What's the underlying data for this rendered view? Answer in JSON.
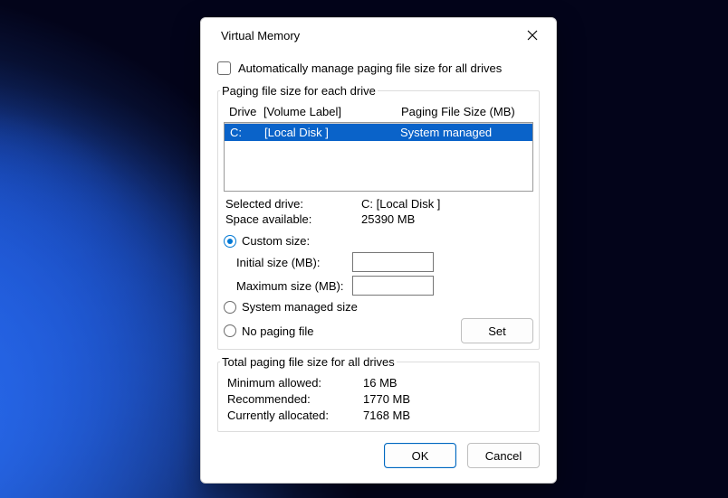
{
  "title": "Virtual Memory",
  "autoManage": {
    "label": "Automatically manage paging file size for all drives",
    "checked": false
  },
  "driveGroup": {
    "legend": "Paging file size for each drive",
    "headerDrive": "Drive",
    "headerLabel": "[Volume Label]",
    "headerSize": "Paging File Size (MB)",
    "rows": [
      {
        "drive": "C:",
        "label": "[Local Disk ]",
        "size": "System managed",
        "selected": true
      }
    ],
    "selectedLabel": "Selected drive:",
    "selectedValue": "C:  [Local Disk ]",
    "spaceLabel": "Space available:",
    "spaceValue": "25390 MB",
    "customLabel": "Custom size:",
    "initialLabel": "Initial size (MB):",
    "initialValue": "",
    "maxLabel": "Maximum size (MB):",
    "maxValue": "",
    "systemManagedLabel": "System managed size",
    "noPagingLabel": "No paging file",
    "choice": "custom",
    "setLabel": "Set"
  },
  "totals": {
    "legend": "Total paging file size for all drives",
    "minLabel": "Minimum allowed:",
    "minValue": "16 MB",
    "recLabel": "Recommended:",
    "recValue": "1770 MB",
    "curLabel": "Currently allocated:",
    "curValue": "7168 MB"
  },
  "buttons": {
    "ok": "OK",
    "cancel": "Cancel"
  }
}
